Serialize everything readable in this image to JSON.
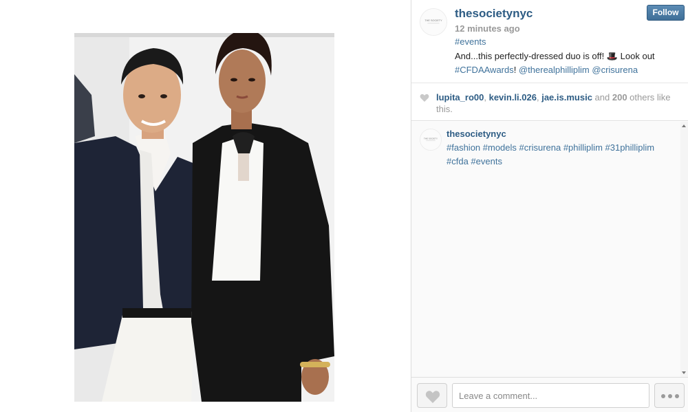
{
  "post": {
    "username": "thesocietynyc",
    "time_ago": "12 minutes ago",
    "tag": "#events",
    "caption": {
      "text": "And...this perfectly-dressed duo is off! 🎩 Look out",
      "link1": "#CFDAAwards",
      "sep1": "! ",
      "link2": "@therealphilliplim",
      "sep2": " ",
      "link3": "@crisurena"
    },
    "follow_label": "Follow",
    "avatar_text": "THE SOCIETY"
  },
  "likes": {
    "users": [
      "lupita_ro00",
      "kevin.li.026",
      "jae.is.music"
    ],
    "sep": ", ",
    "and": " and ",
    "count": "200",
    "suffix": " others like this."
  },
  "comments": [
    {
      "username": "thesocietynyc",
      "text": "#fashion #models #crisurena #phillip​lim #31philliplim #cfda #events"
    }
  ],
  "footer": {
    "comment_placeholder": "Leave a comment..."
  },
  "colors": {
    "link": "#3f729b",
    "username": "#2d5c84",
    "follow_button": "#4e7fa9"
  },
  "icons": [
    "heart-icon",
    "ellipsis-icon",
    "top-hat-emoji"
  ]
}
